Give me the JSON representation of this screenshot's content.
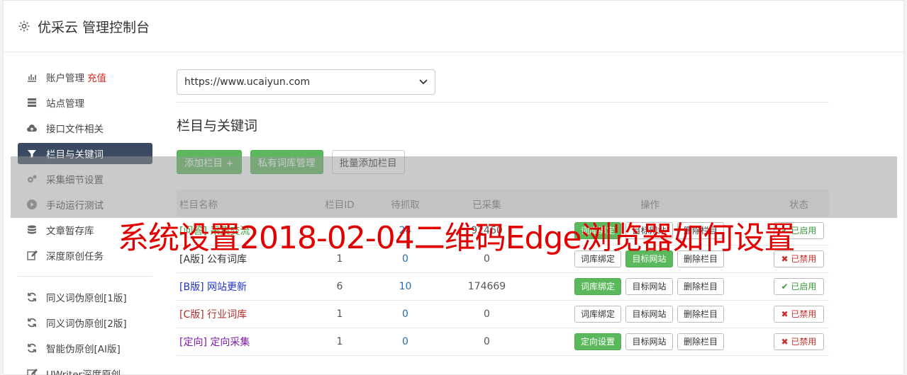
{
  "header": {
    "title": "优采云 管理控制台"
  },
  "sidebar": {
    "items": [
      {
        "label": "账户管理",
        "extra": "充值",
        "icon": "bar-chart-icon"
      },
      {
        "label": "站点管理",
        "icon": "server-icon"
      },
      {
        "label": "接口文件相关",
        "icon": "cloud-upload-icon"
      },
      {
        "label": "栏目与关键词",
        "icon": "filter-icon",
        "active": true
      },
      {
        "label": "采集细节设置",
        "icon": "cogs-icon"
      },
      {
        "label": "手动运行测试",
        "icon": "play-circle-icon"
      },
      {
        "label": "文章暂存库",
        "icon": "database-icon"
      },
      {
        "label": "深度原创任务",
        "icon": "edit-icon"
      }
    ],
    "items2": [
      {
        "label": "同义词伪原创[1版]",
        "icon": "refresh-icon"
      },
      {
        "label": "同义词伪原创[2版]",
        "icon": "refresh-icon"
      },
      {
        "label": "智能伪原创[AI版]",
        "icon": "refresh-icon"
      },
      {
        "label": "UWriter深度原创",
        "icon": "edit-icon"
      }
    ]
  },
  "main": {
    "site_select": "https://www.ucaiyun.com",
    "heading": "栏目与关键词",
    "buttons": {
      "add": "添加栏目 +",
      "private": "私有词库管理",
      "batch": "批量添加栏目"
    },
    "table": {
      "headers": [
        "栏目名称",
        "栏目ID",
        "待抓取",
        "已采集",
        "操作",
        "状态"
      ],
      "rows": [
        {
          "name": "[问答] 采集交流",
          "id": "",
          "pending": "24",
          "collected": "92460",
          "op1": "词库绑定",
          "op2": "目标网站",
          "op3": "删除栏目",
          "status": "已启用"
        },
        {
          "name": "[A版] 公有词库",
          "id": "1",
          "pending": "0",
          "collected": "0",
          "op1": "词库绑定",
          "op2": "目标网站",
          "op3": "删除栏目",
          "status": "已禁用"
        },
        {
          "name": "[B版] 网站更新",
          "id": "6",
          "pending": "10",
          "collected": "174669",
          "op1": "词库绑定",
          "op2": "目标网站",
          "op3": "删除栏目",
          "status": "已启用"
        },
        {
          "name": "[C版] 行业词库",
          "id": "1",
          "pending": "0",
          "collected": "0",
          "op1": "词库绑定",
          "op2": "目标网站",
          "op3": "删除栏目",
          "status": "已禁用"
        },
        {
          "name": "[定向] 定向采集",
          "id": "1",
          "pending": "0",
          "collected": "0",
          "op1": "定向设置",
          "op2": "目标网站",
          "op3": "删除栏目",
          "status": "已禁用"
        }
      ]
    }
  },
  "overlay": {
    "text": "系统设置2018-02-04二维码Edge浏览器如何设置"
  },
  "colors": {
    "accent_green": "#5cb85c",
    "active_nav": "#3a4a63",
    "danger": "#c9302c",
    "overlay_text": "#e00000"
  }
}
